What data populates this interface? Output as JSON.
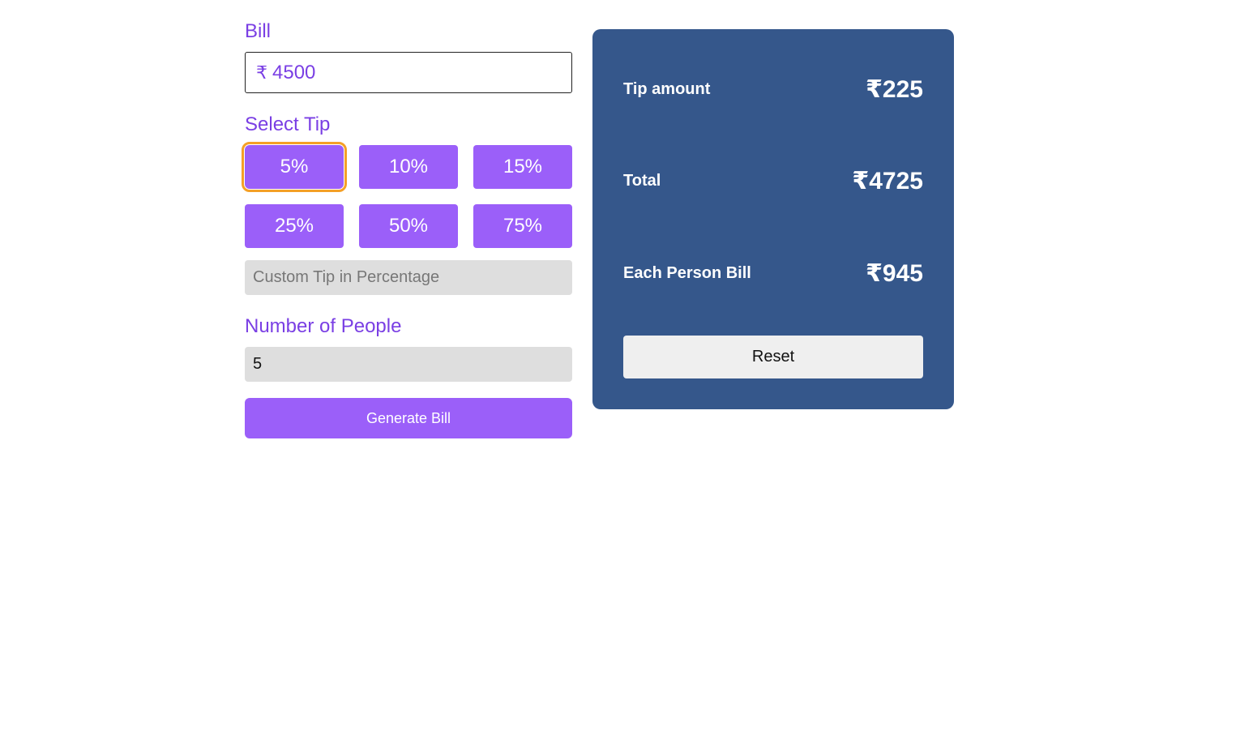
{
  "form": {
    "bill_label": "Bill",
    "currency_symbol": "₹",
    "bill_value": "4500",
    "tip_label": "Select Tip",
    "tip_options": [
      "5%",
      "10%",
      "15%",
      "25%",
      "50%",
      "75%"
    ],
    "selected_tip": "5%",
    "custom_tip_placeholder": "Custom Tip in Percentage",
    "people_label": "Number of People",
    "people_value": "5",
    "generate_label": "Generate Bill"
  },
  "summary": {
    "tip_amount_label": "Tip amount",
    "tip_amount_value": "₹225",
    "total_label": "Total",
    "total_value": "₹4725",
    "each_label": "Each Person Bill",
    "each_value": "₹945",
    "reset_label": "Reset"
  },
  "colors": {
    "accent": "#9b5ff9",
    "label_text": "#7a3fe4",
    "selected_outline": "#f4a026",
    "panel_bg": "#35578b"
  }
}
